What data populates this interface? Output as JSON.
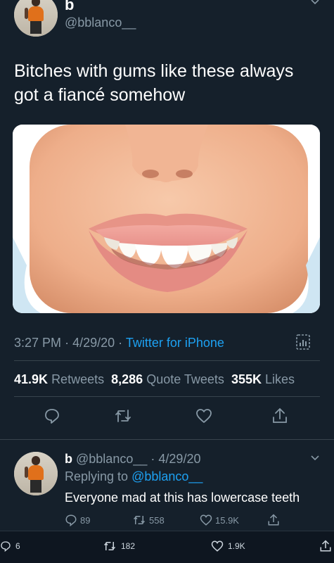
{
  "tweet": {
    "display_name": "b",
    "handle": "@bblanco__",
    "text_line1": "Bitches with gums like these always",
    "text_line2": "got a fiancé somehow",
    "time": "3:27 PM",
    "sep1": "·",
    "date": "4/29/20",
    "sep2": "·",
    "source": "Twitter for iPhone",
    "retweets_count": "41.9K",
    "retweets_label": "Retweets",
    "quotes_count": "8,286",
    "quotes_label": "Quote Tweets",
    "likes_count": "355K",
    "likes_label": "Likes"
  },
  "reply": {
    "display_name": "b",
    "handle": "@bblanco__",
    "sep": "·",
    "date": "4/29/20",
    "replying_prefix": "Replying to",
    "replying_handle": "@bblanco__",
    "text": "Everyone mad at this has lowercase teeth",
    "replies": "89",
    "retweets": "558",
    "likes": "15.9K"
  },
  "bottom_bar": {
    "replies": "6",
    "retweets": "182",
    "likes": "1.9K"
  },
  "colors": {
    "background": "#15202b",
    "accent": "#1da1f2",
    "muted": "#8899a6"
  },
  "icons": [
    "chevron-down-icon",
    "reply-icon",
    "retweet-icon",
    "heart-icon",
    "share-icon",
    "analytics-icon"
  ]
}
